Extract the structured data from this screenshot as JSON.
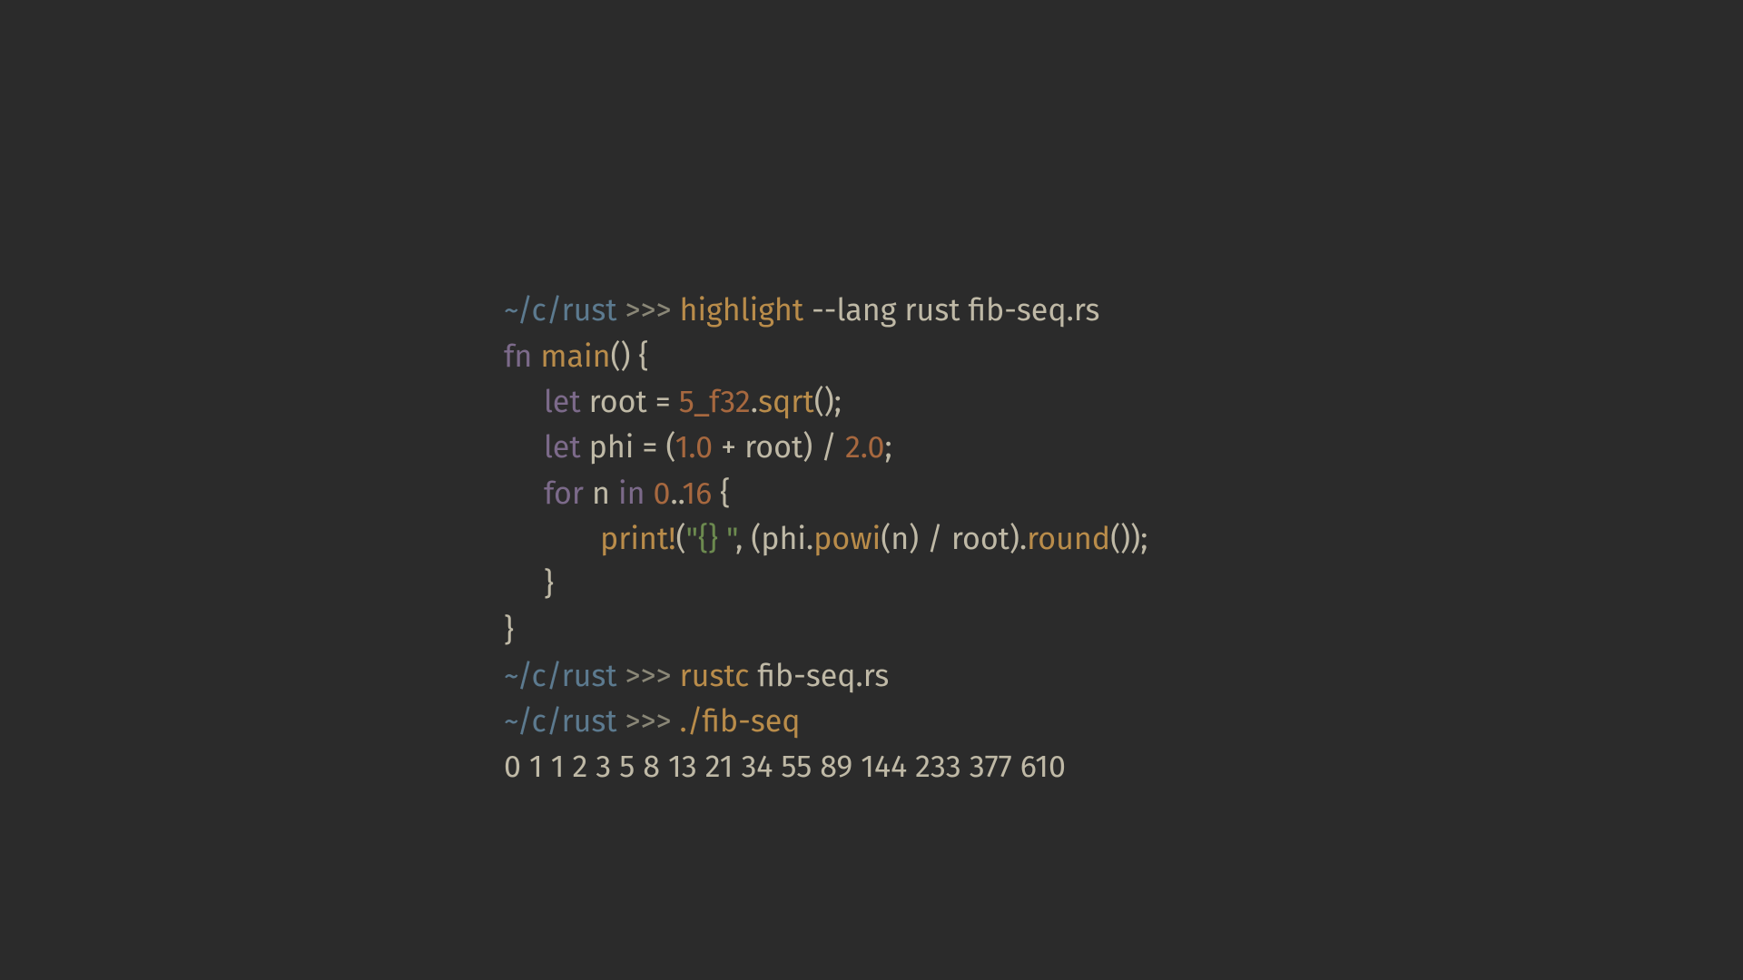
{
  "colors": {
    "bg": "#2b2b2b",
    "path": "#5c7a8f",
    "prompt": "#8a8777",
    "command": "#b98c4a",
    "default": "#bfb9a6",
    "keyword": "#7c6a8a",
    "func": "#b98c4a",
    "number": "#a7683f",
    "string": "#6c8a4f"
  },
  "prompt": {
    "path": "~/c/rust",
    "chevrons": ">>>"
  },
  "cmd1": {
    "name": "highlight",
    "args": " --lang rust fib-seq.rs"
  },
  "code": {
    "l1_fn": "fn",
    "l1_main": "main",
    "l1_rest": "() {",
    "l2_let": "let",
    "l2_root": " root ",
    "l2_eq": "= ",
    "l2_num": "5_f32",
    "l2_dot": ".",
    "l2_sqrt": "sqrt",
    "l2_end": "();",
    "l3_let": "let",
    "l3_phi": " phi ",
    "l3_eq": "= (",
    "l3_n1": "1.0",
    "l3_plus": " + root) / ",
    "l3_n2": "2.0",
    "l3_end": ";",
    "l4_for": "for",
    "l4_n": " n ",
    "l4_in": "in",
    "l4_sp": " ",
    "l4_r1": "0",
    "l4_dots": "..",
    "l4_r2": "16",
    "l4_end": " {",
    "l5_print": "print!",
    "l5_p1": "(",
    "l5_str": "\"{} \"",
    "l5_p2": ", (phi.",
    "l5_powi": "powi",
    "l5_p3": "(n) / root).",
    "l5_round": "round",
    "l5_p4": "());",
    "l6": "}",
    "l7": "}"
  },
  "cmd2": {
    "name": "rustc",
    "args": " fib-seq.rs"
  },
  "cmd3": {
    "name": "./fib-seq"
  },
  "output": "0 1 1 2 3 5 8 13 21 34 55 89 144 233 377 610"
}
